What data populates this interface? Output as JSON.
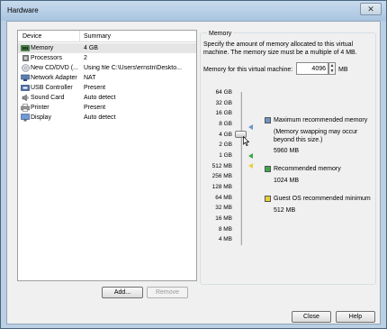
{
  "window": {
    "title": "Hardware",
    "close_glyph": "✕"
  },
  "device_list": {
    "columns": [
      "Device",
      "Summary"
    ],
    "items": [
      {
        "icon": "memory-icon",
        "name": "Memory",
        "summary": "4 GB",
        "selected": true
      },
      {
        "icon": "processor-icon",
        "name": "Processors",
        "summary": "2"
      },
      {
        "icon": "cd-dvd-icon",
        "name": "New CD/DVD (...",
        "summary": "Using file C:\\Users\\ernstn\\Deskto..."
      },
      {
        "icon": "network-adapter-icon",
        "name": "Network Adapter",
        "summary": "NAT"
      },
      {
        "icon": "usb-icon",
        "name": "USB Controller",
        "summary": "Present"
      },
      {
        "icon": "sound-card-icon",
        "name": "Sound Card",
        "summary": "Auto detect"
      },
      {
        "icon": "printer-icon",
        "name": "Printer",
        "summary": "Present"
      },
      {
        "icon": "display-icon",
        "name": "Display",
        "summary": "Auto detect"
      }
    ],
    "add_label": "Add...",
    "remove_label": "Remove"
  },
  "memory": {
    "group_title": "Memory",
    "description": "Specify the amount of memory allocated to this virtual machine. The memory size must be a multiple of 4 MB.",
    "input_label": "Memory for this virtual machine:",
    "input_value": "4096",
    "unit": "MB",
    "ticks": [
      "64 GB",
      "32 GB",
      "16 GB",
      "8 GB",
      "4 GB",
      "2 GB",
      "1 GB",
      "512 MB",
      "256 MB",
      "128 MB",
      "64 MB",
      "32 MB",
      "16 MB",
      "8 MB",
      "4 MB"
    ],
    "legend": {
      "max": {
        "title": "Maximum recommended memory",
        "note": "(Memory swapping may occur beyond this size.)",
        "value": "5960 MB",
        "color": "#6f93c4"
      },
      "rec": {
        "title": "Recommended memory",
        "value": "1024 MB",
        "color": "#3ca84a"
      },
      "guest": {
        "title": "Guest OS recommended minimum",
        "value": "512 MB",
        "color": "#e9cf3a"
      }
    }
  },
  "footer": {
    "close_label": "Close",
    "help_label": "Help"
  }
}
